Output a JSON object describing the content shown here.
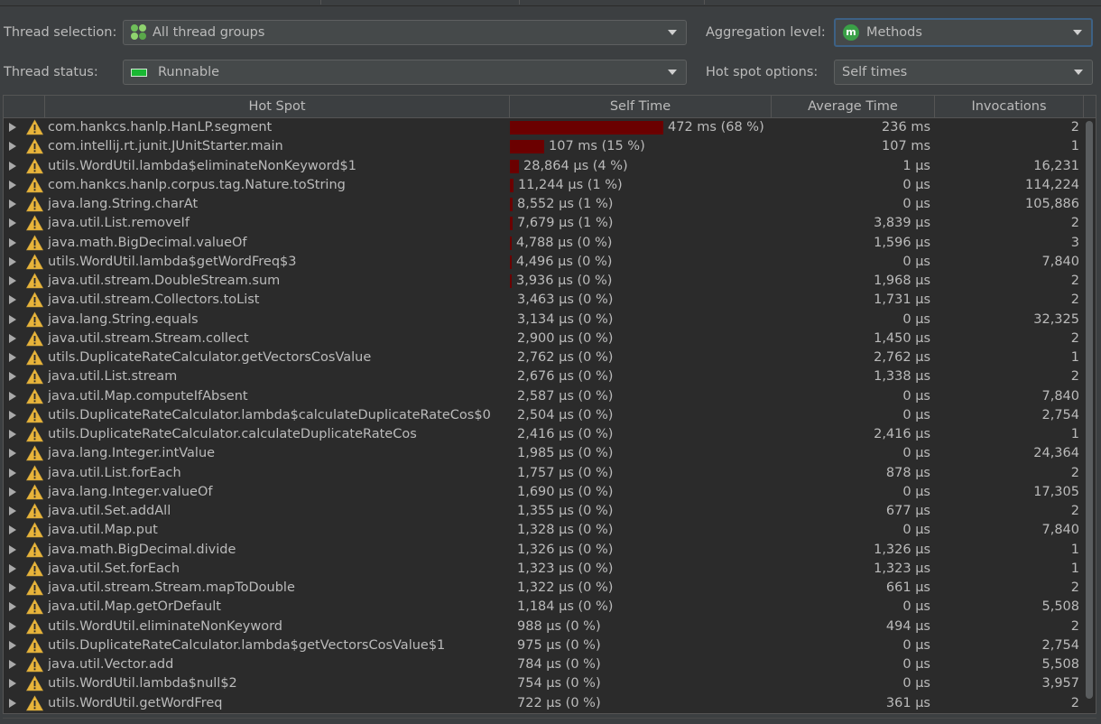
{
  "controls": {
    "thread_selection_label": "Thread selection:",
    "thread_selection_value": "All thread groups",
    "thread_status_label": "Thread status:",
    "thread_status_value": "Runnable",
    "aggregation_label": "Aggregation level:",
    "aggregation_value": "Methods",
    "aggregation_icon_letter": "m",
    "hotspot_options_label": "Hot spot options:",
    "hotspot_options_value": "Self times"
  },
  "icons": {
    "thread_groups": "thread-groups-icon",
    "runnable": "runnable-status-icon",
    "methods": "methods-icon",
    "warning": "warning-icon",
    "expand": "expand-arrow-icon",
    "dropdown": "chevron-down-icon"
  },
  "colors": {
    "background": "#3c3f41",
    "table_background": "#2b2b2b",
    "bar": "#6b0000",
    "runnable_green": "#19b833",
    "methods_green": "#3aa047",
    "warning_yellow": "#e8b43a",
    "focus_border": "#3d6185"
  },
  "table": {
    "headers": [
      "Hot Spot",
      "Self Time",
      "Average Time",
      "Invocations"
    ],
    "rows": [
      {
        "hotspot": "com.hankcs.hanlp.HanLP.segment",
        "self": "472 ms (68 %)",
        "avg": "236 ms",
        "inv": "2",
        "pct": 68
      },
      {
        "hotspot": "com.intellij.rt.junit.JUnitStarter.main",
        "self": "107 ms (15 %)",
        "avg": "107 ms",
        "inv": "1",
        "pct": 15
      },
      {
        "hotspot": "utils.WordUtil.lambda$eliminateNonKeyword$1",
        "self": "28,864 µs (4 %)",
        "avg": "1 µs",
        "inv": "16,231",
        "pct": 4
      },
      {
        "hotspot": "com.hankcs.hanlp.corpus.tag.Nature.toString",
        "self": "11,244 µs (1 %)",
        "avg": "0 µs",
        "inv": "114,224",
        "pct": 1.6
      },
      {
        "hotspot": "java.lang.String.charAt",
        "self": "8,552 µs (1 %)",
        "avg": "0 µs",
        "inv": "105,886",
        "pct": 1.2
      },
      {
        "hotspot": "java.util.List.removeIf",
        "self": "7,679 µs (1 %)",
        "avg": "3,839 µs",
        "inv": "2",
        "pct": 1.1
      },
      {
        "hotspot": "java.math.BigDecimal.valueOf",
        "self": "4,788 µs (0 %)",
        "avg": "1,596 µs",
        "inv": "3",
        "pct": 0.7
      },
      {
        "hotspot": "utils.WordUtil.lambda$getWordFreq$3",
        "self": "4,496 µs (0 %)",
        "avg": "0 µs",
        "inv": "7,840",
        "pct": 0.65
      },
      {
        "hotspot": "java.util.stream.DoubleStream.sum",
        "self": "3,936 µs (0 %)",
        "avg": "1,968 µs",
        "inv": "2",
        "pct": 0.57
      },
      {
        "hotspot": "java.util.stream.Collectors.toList",
        "self": "3,463 µs (0 %)",
        "avg": "1,731 µs",
        "inv": "2",
        "pct": 0
      },
      {
        "hotspot": "java.lang.String.equals",
        "self": "3,134 µs (0 %)",
        "avg": "0 µs",
        "inv": "32,325",
        "pct": 0
      },
      {
        "hotspot": "java.util.stream.Stream.collect",
        "self": "2,900 µs (0 %)",
        "avg": "1,450 µs",
        "inv": "2",
        "pct": 0
      },
      {
        "hotspot": "utils.DuplicateRateCalculator.getVectorsCosValue",
        "self": "2,762 µs (0 %)",
        "avg": "2,762 µs",
        "inv": "1",
        "pct": 0
      },
      {
        "hotspot": "java.util.List.stream",
        "self": "2,676 µs (0 %)",
        "avg": "1,338 µs",
        "inv": "2",
        "pct": 0
      },
      {
        "hotspot": "java.util.Map.computeIfAbsent",
        "self": "2,587 µs (0 %)",
        "avg": "0 µs",
        "inv": "7,840",
        "pct": 0
      },
      {
        "hotspot": "utils.DuplicateRateCalculator.lambda$calculateDuplicateRateCos$0",
        "self": "2,504 µs (0 %)",
        "avg": "0 µs",
        "inv": "2,754",
        "pct": 0
      },
      {
        "hotspot": "utils.DuplicateRateCalculator.calculateDuplicateRateCos",
        "self": "2,416 µs (0 %)",
        "avg": "2,416 µs",
        "inv": "1",
        "pct": 0
      },
      {
        "hotspot": "java.lang.Integer.intValue",
        "self": "1,985 µs (0 %)",
        "avg": "0 µs",
        "inv": "24,364",
        "pct": 0
      },
      {
        "hotspot": "java.util.List.forEach",
        "self": "1,757 µs (0 %)",
        "avg": "878 µs",
        "inv": "2",
        "pct": 0
      },
      {
        "hotspot": "java.lang.Integer.valueOf",
        "self": "1,690 µs (0 %)",
        "avg": "0 µs",
        "inv": "17,305",
        "pct": 0
      },
      {
        "hotspot": "java.util.Set.addAll",
        "self": "1,355 µs (0 %)",
        "avg": "677 µs",
        "inv": "2",
        "pct": 0
      },
      {
        "hotspot": "java.util.Map.put",
        "self": "1,328 µs (0 %)",
        "avg": "0 µs",
        "inv": "7,840",
        "pct": 0
      },
      {
        "hotspot": "java.math.BigDecimal.divide",
        "self": "1,326 µs (0 %)",
        "avg": "1,326 µs",
        "inv": "1",
        "pct": 0
      },
      {
        "hotspot": "java.util.Set.forEach",
        "self": "1,323 µs (0 %)",
        "avg": "1,323 µs",
        "inv": "1",
        "pct": 0
      },
      {
        "hotspot": "java.util.stream.Stream.mapToDouble",
        "self": "1,322 µs (0 %)",
        "avg": "661 µs",
        "inv": "2",
        "pct": 0
      },
      {
        "hotspot": "java.util.Map.getOrDefault",
        "self": "1,184 µs (0 %)",
        "avg": "0 µs",
        "inv": "5,508",
        "pct": 0
      },
      {
        "hotspot": "utils.WordUtil.eliminateNonKeyword",
        "self": "988 µs (0 %)",
        "avg": "494 µs",
        "inv": "2",
        "pct": 0
      },
      {
        "hotspot": "utils.DuplicateRateCalculator.lambda$getVectorsCosValue$1",
        "self": "975 µs (0 %)",
        "avg": "0 µs",
        "inv": "2,754",
        "pct": 0
      },
      {
        "hotspot": "java.util.Vector.add",
        "self": "784 µs (0 %)",
        "avg": "0 µs",
        "inv": "5,508",
        "pct": 0
      },
      {
        "hotspot": "utils.WordUtil.lambda$null$2",
        "self": "754 µs (0 %)",
        "avg": "0 µs",
        "inv": "3,957",
        "pct": 0
      },
      {
        "hotspot": "utils.WordUtil.getWordFreq",
        "self": "722 µs (0 %)",
        "avg": "361 µs",
        "inv": "2",
        "pct": 0
      }
    ]
  }
}
